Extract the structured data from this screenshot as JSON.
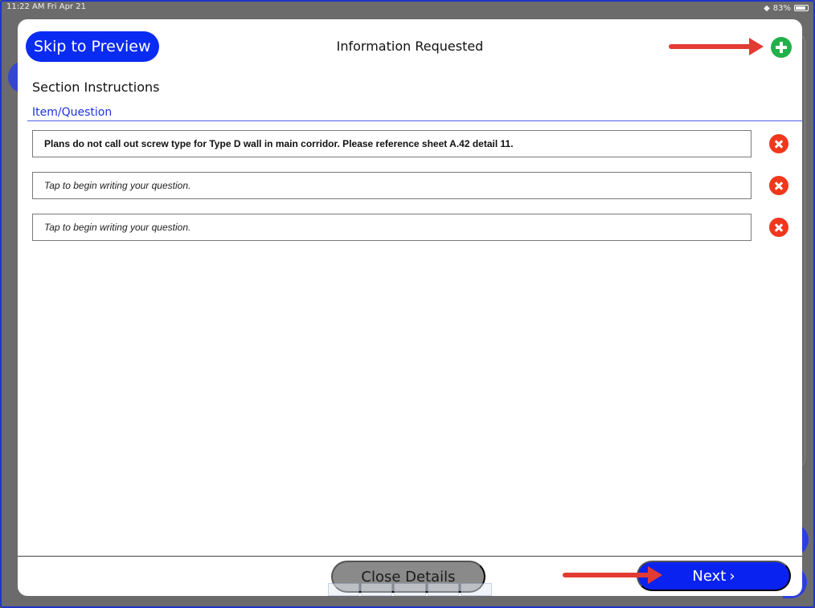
{
  "status_bar": {
    "time": "11:22 AM  Fri Apr 21",
    "battery": "83%"
  },
  "sheet": {
    "skip_label": "Skip to Preview",
    "title": "Information Requested",
    "section_title": "Section Instructions",
    "column_header": "Item/Question"
  },
  "questions": [
    "Plans do not call out screw type for Type D wall in main corridor. Please reference sheet A.42 detail 11.",
    "Tap to begin writing your question.",
    "Tap to begin writing your question."
  ],
  "footer": {
    "close_label": "Close Details",
    "next_label": "Next",
    "next_chevron": "›"
  },
  "colors": {
    "accent": "#0a22f0",
    "add": "#22b04a",
    "remove": "#f1371c",
    "annotation_arrow": "#e23b33"
  }
}
